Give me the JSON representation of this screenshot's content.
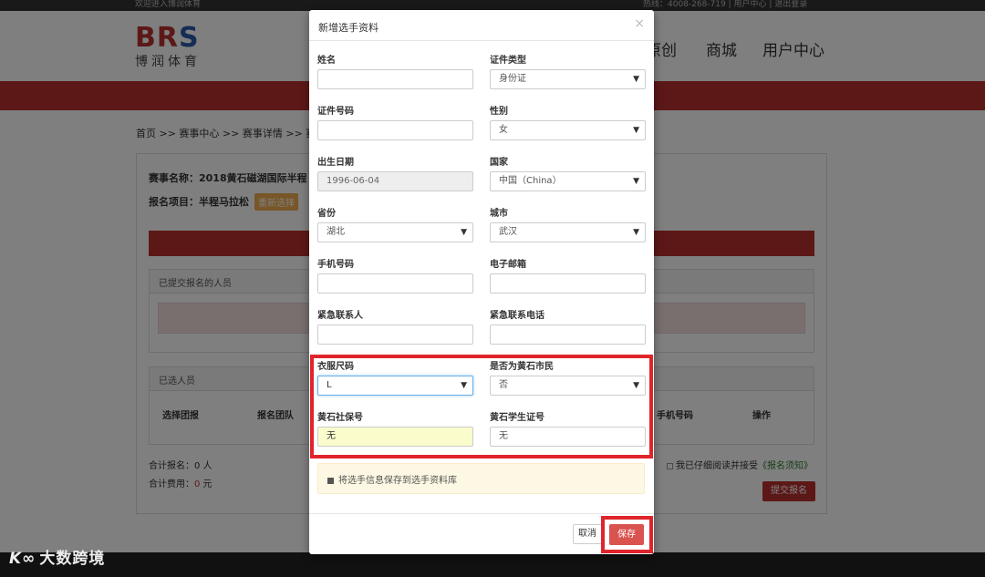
{
  "topbar": {
    "left_text": "欢迎进入博润体育",
    "right_text": "热线：4008-268-719 | 用户中心 | 退出登录"
  },
  "logo": {
    "brand_main": "BR",
    "brand_s": "S",
    "brand_cn": "博润体育"
  },
  "nav": {
    "items": [
      "原创",
      "商城",
      "用户中心"
    ]
  },
  "breadcrumb": "首页 >> 赛事中心 >> 赛事详情 >> 赛",
  "event": {
    "name": "赛事名称：2018黄石磁湖国际半程",
    "item": "报名项目：半程马拉松",
    "reselect": "重新选择"
  },
  "submitted": {
    "title": "已提交报名的人员"
  },
  "selected": {
    "title": "已选人员",
    "columns": [
      "选择团报",
      "报名团队",
      "手机号码",
      "操作"
    ]
  },
  "totals": {
    "count_label": "合计报名：",
    "count_value": "0 人",
    "fee_label": "合计费用：",
    "fee_value": "0",
    "fee_unit": " 元"
  },
  "agreement": {
    "text": "我已仔细阅读并接受",
    "link": "《报名须知》"
  },
  "submit_button": "提交报名",
  "watermark": {
    "mark": "K∞",
    "text": "大数跨境"
  },
  "modal": {
    "title": "新增选手资料",
    "close": "×",
    "fields": {
      "name": {
        "label": "姓名",
        "value": ""
      },
      "id_type": {
        "label": "证件类型",
        "value": "身份证"
      },
      "id_number": {
        "label": "证件号码",
        "value": ""
      },
      "gender": {
        "label": "性别",
        "value": "女"
      },
      "birth_date": {
        "label": "出生日期",
        "value": "1996-06-04"
      },
      "country": {
        "label": "国家",
        "value": "中国（China）"
      },
      "province": {
        "label": "省份",
        "value": "湖北"
      },
      "city": {
        "label": "城市",
        "value": "武汉"
      },
      "phone": {
        "label": "手机号码",
        "value": ""
      },
      "email": {
        "label": "电子邮箱",
        "value": ""
      },
      "emergency_contact": {
        "label": "紧急联系人",
        "value": ""
      },
      "emergency_phone": {
        "label": "紧急联系电话",
        "value": ""
      },
      "shirt_size": {
        "label": "衣服尺码",
        "value": "L"
      },
      "is_huangshi_resident": {
        "label": "是否为黄石市民",
        "value": "否"
      },
      "huangshi_social_security": {
        "label": "黄石社保号",
        "value": "无"
      },
      "huangshi_student_id": {
        "label": "黄石学生证号",
        "value": "无"
      }
    },
    "save_to_library": "将选手信息保存到选手资料库",
    "cancel": "取消",
    "save": "保存",
    "dropdown_arrow": "▼"
  },
  "colors": {
    "brand_red": "#b8312f",
    "highlight_red": "#e0242b",
    "save_button": "#d9534f"
  }
}
